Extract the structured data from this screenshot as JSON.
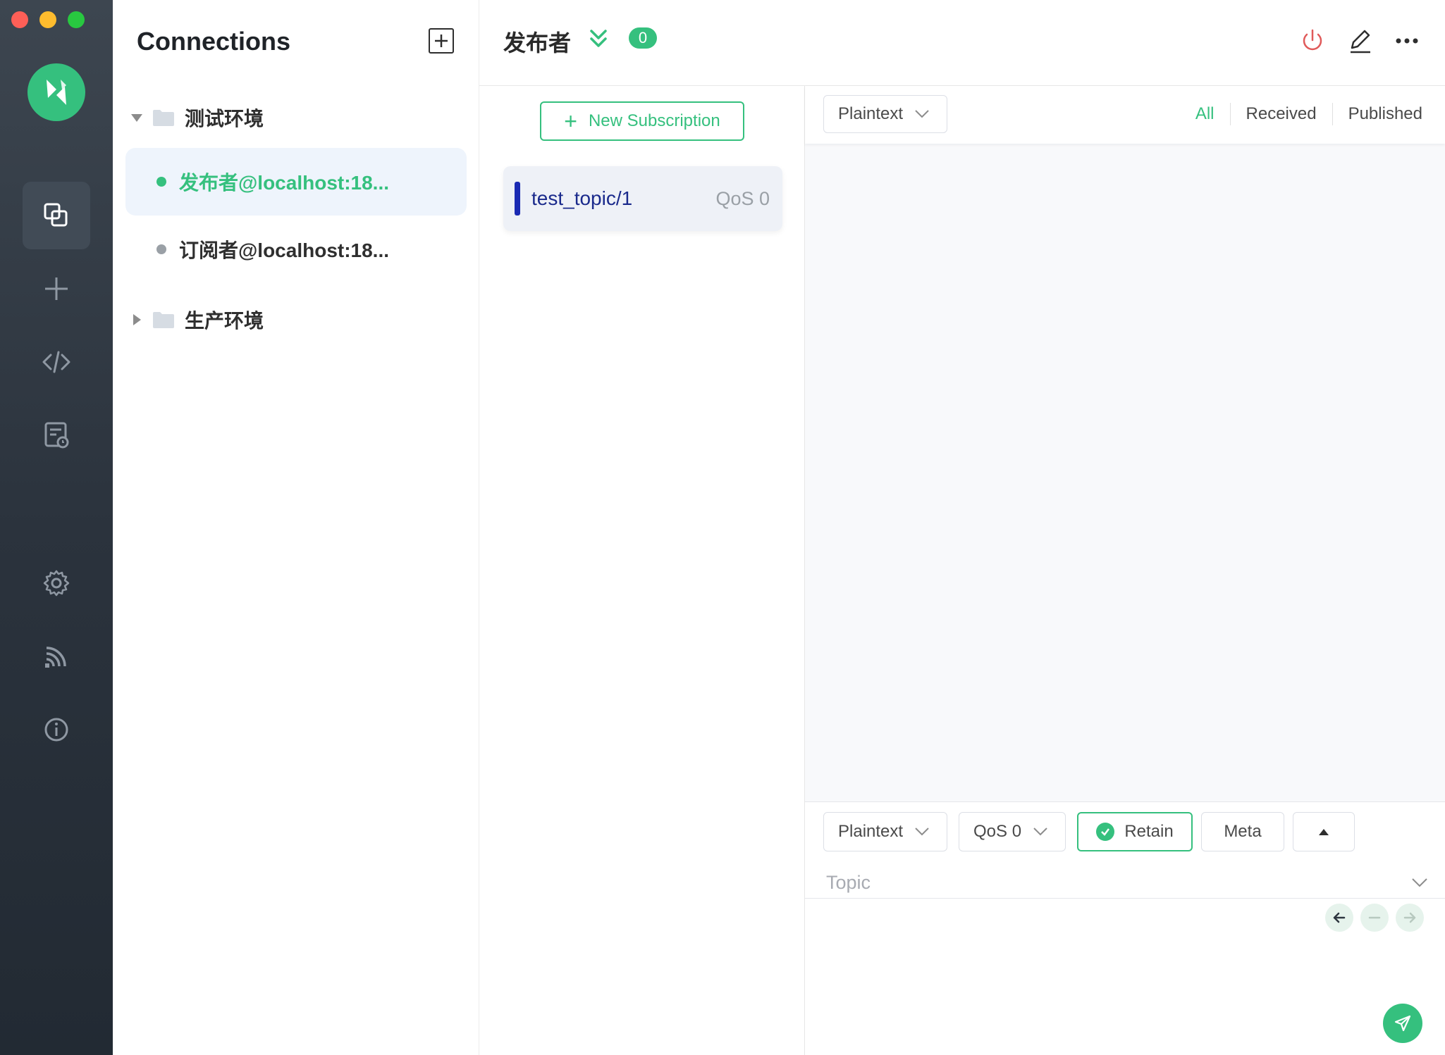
{
  "window": {
    "traffic_lights": [
      "close",
      "minimize",
      "zoom"
    ]
  },
  "rail": {
    "logo": "mqttx-logo-icon",
    "items": [
      {
        "icon": "connections-icon",
        "active": true
      },
      {
        "icon": "plus-icon",
        "active": false
      },
      {
        "icon": "code-icon",
        "active": false
      },
      {
        "icon": "log-icon",
        "active": false
      },
      {
        "icon": "gear-icon",
        "active": false
      },
      {
        "icon": "rss-icon",
        "active": false
      },
      {
        "icon": "info-icon",
        "active": false
      }
    ]
  },
  "connections": {
    "title": "Connections",
    "groups": [
      {
        "name": "测试环境",
        "expanded": true,
        "items": [
          {
            "name": "发布者@localhost:18...",
            "status": "connected",
            "active": true
          },
          {
            "name": "订阅者@localhost:18...",
            "status": "disconnected",
            "active": false
          }
        ]
      },
      {
        "name": "生产环境",
        "expanded": false,
        "items": []
      }
    ]
  },
  "header": {
    "title": "发布者",
    "badge_count": "0"
  },
  "subscriptions": {
    "new_button_label": "New Subscription",
    "items": [
      {
        "topic": "test_topic/1",
        "qos": "QoS 0",
        "color": "#1a2ab3"
      }
    ]
  },
  "messages": {
    "format": "Plaintext",
    "filters": [
      "All",
      "Received",
      "Published"
    ],
    "active_filter": "All"
  },
  "publish": {
    "format": "Plaintext",
    "qos": "QoS 0",
    "retain_label": "Retain",
    "retain_checked": true,
    "meta_label": "Meta",
    "topic_placeholder": "Topic",
    "topic_value": ""
  },
  "colors": {
    "accent": "#35c07e",
    "danger": "#e05a5a",
    "sub_bar": "#1a2ab3"
  }
}
